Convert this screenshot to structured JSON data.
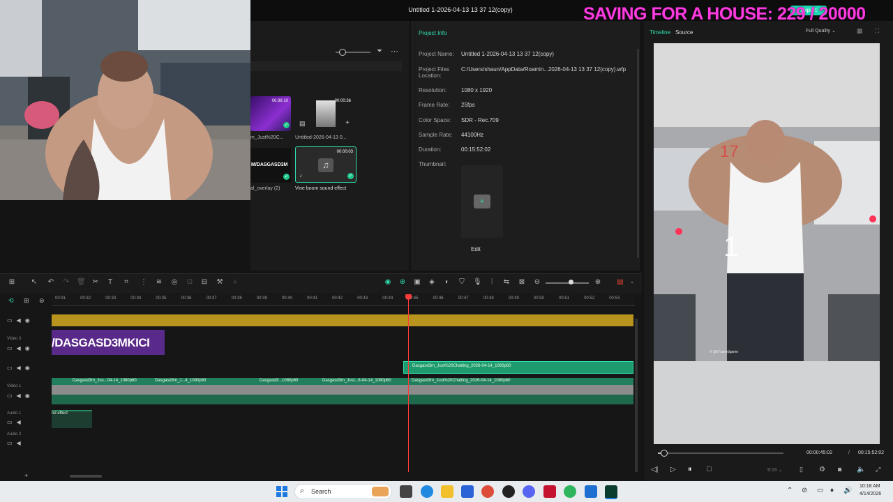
{
  "window": {
    "title": "Untitled 1-2026-04-13 13 37 12(copy)",
    "export_label": "Export"
  },
  "overlay": {
    "saving_text": "SAVING FOR A HOUSE: 229 / 20000"
  },
  "media": {
    "items": [
      {
        "duration": "06:36:10",
        "name": "m_Just%20C..."
      },
      {
        "duration": "00:00:36",
        "name": "Untitled-2026-04-13 0..."
      },
      {
        "duration": "",
        "name": "al_overlay (2)",
        "overlay_text": "M/DASGASD3M"
      },
      {
        "duration": "00:00:03",
        "name": "Vine boom sound effect"
      }
    ]
  },
  "project_info": {
    "tab": "Project Info",
    "fields": [
      {
        "label": "Project Name:",
        "value": "Untitled 1-2026-04-13 13 37 12(copy)"
      },
      {
        "label": "Project Files",
        "label2": "Location:",
        "value": "C:/Users/shaun/AppData/Roamin...2026-04-13 13 37 12(copy).wfp"
      },
      {
        "label": "Resolution:",
        "value": "1080 x 1920"
      },
      {
        "label": "Frame Rate:",
        "value": "25fps"
      },
      {
        "label": "Color Space:",
        "value": "SDR - Rec.709"
      },
      {
        "label": "Sample Rate:",
        "value": "44100Hz"
      },
      {
        "label": "Duration:",
        "value": "00:15:52:02"
      },
      {
        "label": "Thumbnail:",
        "value": ""
      }
    ],
    "edit_label": "Edit"
  },
  "preview": {
    "tabs": [
      "Timeline",
      "Source"
    ],
    "quality": "Full Quality",
    "current_time": "00:00:45:02",
    "separator": "/",
    "total_time": "00:15:52:02",
    "aspect": "9:16",
    "overlay_number_red": "17",
    "overlay_number_white": "1",
    "watermark": "X @k7speedgame",
    "playhead_fraction": 0.047
  },
  "timeline": {
    "ruler": [
      "00:31",
      "00:32",
      "00:33",
      "00:34",
      "00:35",
      "00:36",
      "00:37",
      "00:38",
      "00:39",
      "00:40",
      "00:41",
      "00:42",
      "00:43",
      "00:44",
      "00:45",
      "00:46",
      "00:47",
      "00:48",
      "00:49",
      "00:50",
      "00:51",
      "00:52",
      "00:53"
    ],
    "tracks": [
      "Video 3",
      "Video 1",
      "Audio 1",
      "Audio 2"
    ],
    "title_clip_text": "/DASGASD3MKICI",
    "clip_labels": [
      "Dasgasd3m_Just%20Chatting_2026-04-14_1080p60",
      "Dasgasd3m_Jus...04-14_1080p60",
      "Dasgasd3m_J...4_1080p60",
      "Dasgasd3...1080p60",
      "Dasgasd3m_Just...6-04-14_1080p60",
      "Dasgasd3m_Just%20Chatting_2026-04-14_1080p60"
    ],
    "audio_clip_label": "nd effect"
  },
  "taskbar": {
    "search_placeholder": "Search",
    "time": "10:18 AM",
    "date": "4/14/2026"
  }
}
